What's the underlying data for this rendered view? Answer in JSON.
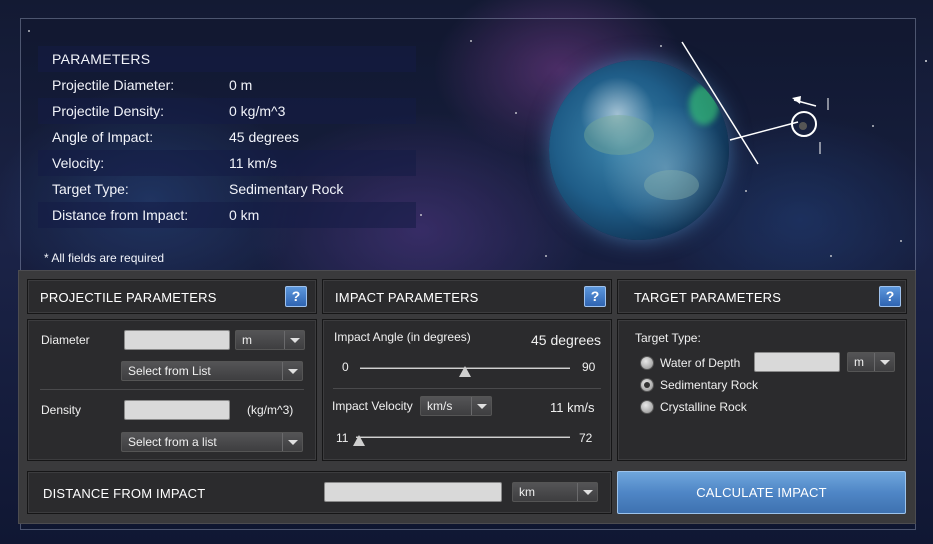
{
  "parameters": {
    "heading": "PARAMETERS",
    "rows": [
      {
        "label": "Projectile Diameter:",
        "value": "0 m"
      },
      {
        "label": "Projectile Density:",
        "value": "0 kg/m^3"
      },
      {
        "label": "Angle of Impact:",
        "value": "45 degrees"
      },
      {
        "label": "Velocity:",
        "value": "11 km/s"
      },
      {
        "label": "Target Type:",
        "value": "Sedimentary Rock"
      },
      {
        "label": "Distance from Impact:",
        "value": "0 km"
      }
    ],
    "required_note": "* All fields are required"
  },
  "projectile": {
    "title": "PROJECTILE PARAMETERS",
    "help": "?",
    "diameter_label": "Diameter",
    "diameter_value": "",
    "diameter_unit": "m",
    "diameter_select": "Select from List",
    "density_label": "Density",
    "density_value": "",
    "density_unit": "(kg/m^3)",
    "density_select": "Select from a list"
  },
  "impact": {
    "title": "IMPACT PARAMETERS",
    "help": "?",
    "angle_label": "Impact Angle (in degrees)",
    "angle_value": "45 degrees",
    "angle_min": "0",
    "angle_max": "90",
    "angle_fraction": 0.5,
    "velocity_label": "Impact Velocity",
    "velocity_unit": "km/s",
    "velocity_value": "11 km/s",
    "velocity_min": "11",
    "velocity_max": "72",
    "velocity_fraction": 0.0
  },
  "target": {
    "title": "TARGET PARAMETERS",
    "help": "?",
    "type_label": "Target Type:",
    "options": [
      {
        "label": "Water of Depth",
        "selected": false
      },
      {
        "label": "Sedimentary Rock",
        "selected": true
      },
      {
        "label": "Crystalline Rock",
        "selected": false
      }
    ],
    "water_depth_value": "",
    "water_depth_unit": "m"
  },
  "distance": {
    "label": "DISTANCE FROM IMPACT",
    "value": "",
    "unit": "km"
  },
  "calculate_label": "CALCULATE IMPACT",
  "colors": {
    "accent": "#4f86c6",
    "panel": "#3a3a3c",
    "box": "#2b2b2d"
  }
}
